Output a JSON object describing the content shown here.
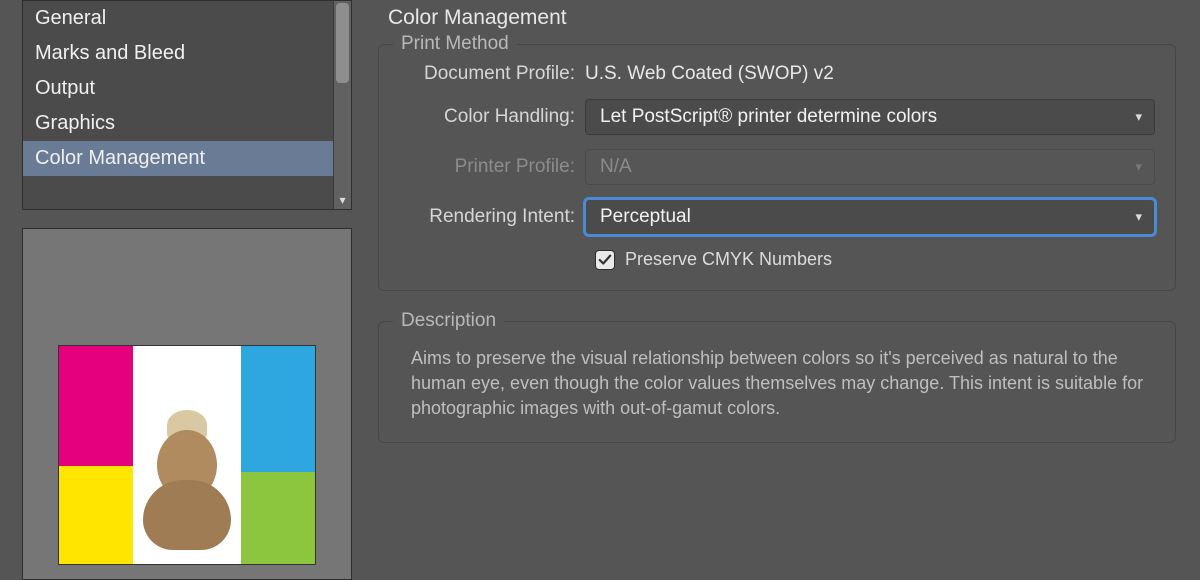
{
  "sidebar": {
    "items": [
      {
        "label": "General"
      },
      {
        "label": "Marks and Bleed"
      },
      {
        "label": "Output"
      },
      {
        "label": "Graphics"
      },
      {
        "label": "Color Management"
      }
    ],
    "selected_index": 4
  },
  "main": {
    "title": "Color Management",
    "print_method": {
      "legend": "Print Method",
      "document_profile_label": "Document Profile:",
      "document_profile_value": "U.S. Web Coated (SWOP) v2",
      "color_handling_label": "Color Handling:",
      "color_handling_value": "Let PostScript® printer determine colors",
      "printer_profile_label": "Printer Profile:",
      "printer_profile_value": "N/A",
      "rendering_intent_label": "Rendering Intent:",
      "rendering_intent_value": "Perceptual",
      "preserve_cmyk_label": "Preserve CMYK Numbers",
      "preserve_cmyk_checked": true
    },
    "description": {
      "legend": "Description",
      "text": "Aims to preserve the visual relationship between colors so it's perceived as natural to the human eye, even though the color values themselves may change. This intent is suitable for photographic images with out-of-gamut colors."
    }
  }
}
